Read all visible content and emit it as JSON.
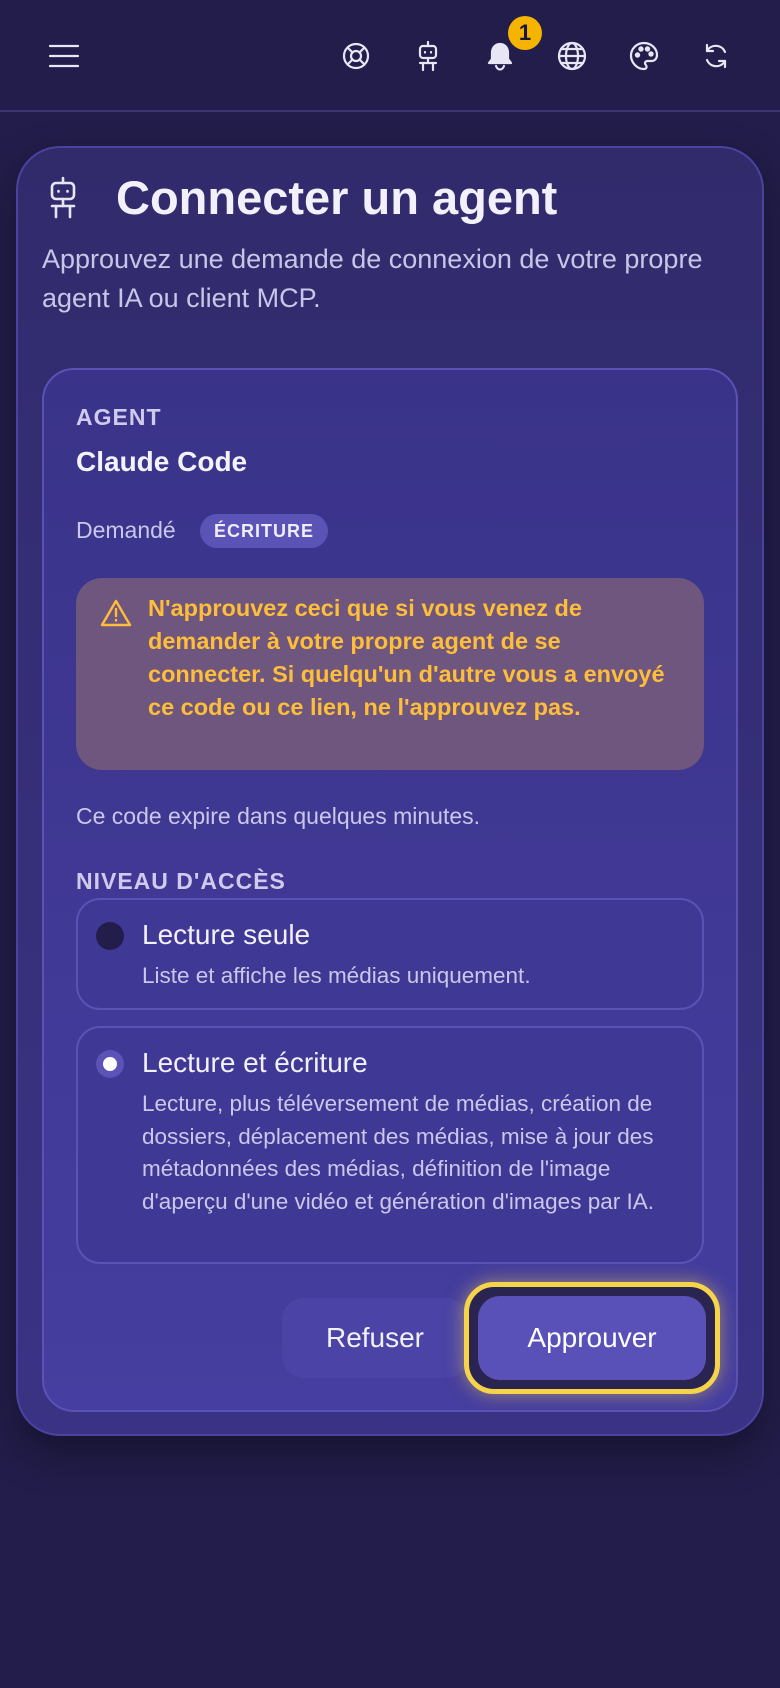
{
  "header": {
    "icons": [
      "menu-icon",
      "help-lifebuoy-icon",
      "robot-icon",
      "bell-icon",
      "globe-icon",
      "palette-icon",
      "refresh-icon"
    ],
    "notification_count": "1"
  },
  "page": {
    "title": "Connecter un agent",
    "subtitle": "Approuvez une demande de connexion de votre propre agent IA ou client MCP."
  },
  "request": {
    "agent_label": "AGENT",
    "agent_name": "Claude Code",
    "requested_label": "Demandé",
    "requested_scope": "ÉCRITURE",
    "warning": "N'approuvez ceci que si vous venez de demander à votre propre agent de se connecter. Si quelqu'un d'autre vous a envoyé ce code ou ce lien, ne l'approuvez pas.",
    "expiry_note": "Ce code expire dans quelques minutes."
  },
  "access": {
    "label": "NIVEAU D'ACCÈS",
    "options": [
      {
        "title": "Lecture seule",
        "description": "Liste et affiche les médias uniquement.",
        "selected": false
      },
      {
        "title": "Lecture et écriture",
        "description": "Lecture, plus téléversement de médias, création de dossiers, déplacement des médias, mise à jour des métadonnées des médias, définition de l'image d'aperçu d'une vidéo et génération d'images par IA.",
        "selected": true
      }
    ]
  },
  "actions": {
    "refuse_label": "Refuser",
    "approve_label": "Approuver"
  },
  "colors": {
    "background": "#221d4a",
    "card": "#3a3389",
    "accent": "#5a51b8",
    "warning_text": "#ffbe3a",
    "focus_ring": "#f5d44a",
    "badge": "#f4b400"
  }
}
